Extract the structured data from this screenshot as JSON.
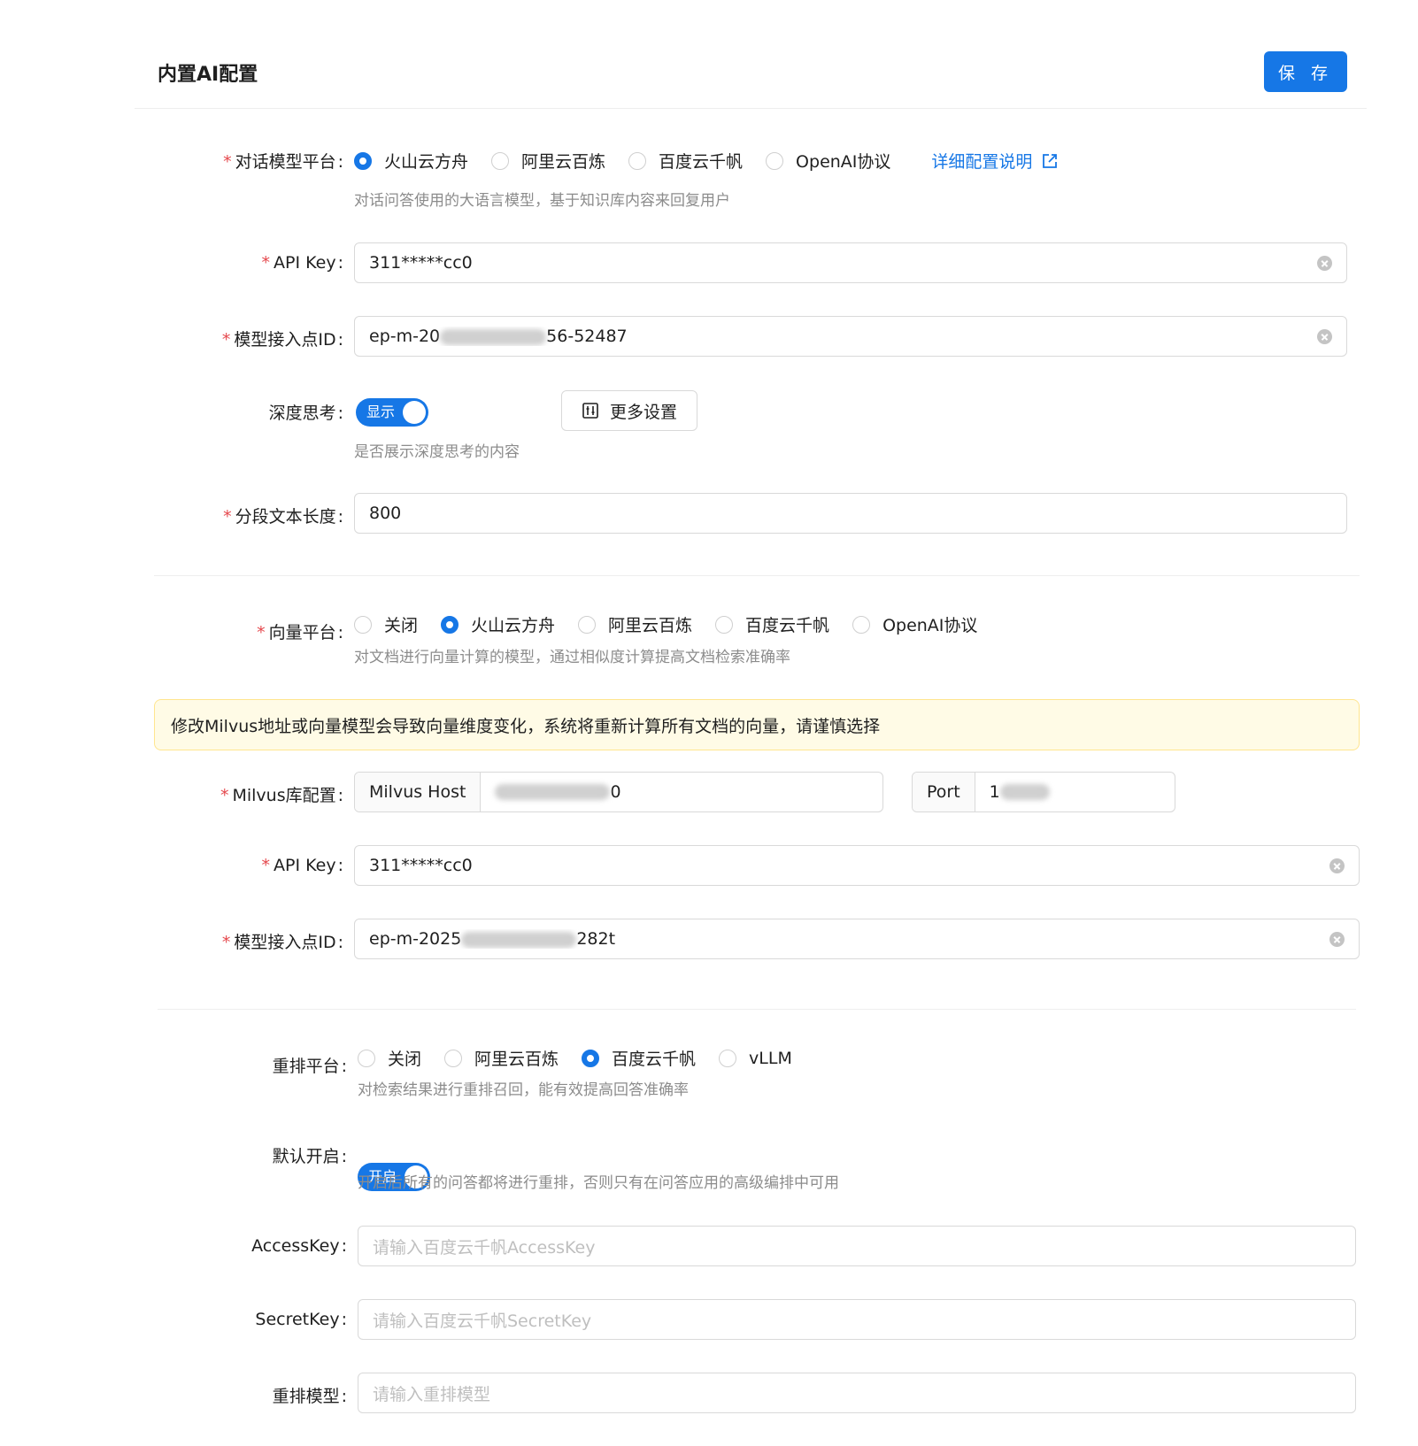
{
  "header": {
    "title": "内置AI配置",
    "save_label": "保 存"
  },
  "chat": {
    "platform_label": "对话模型平台",
    "platform_options": [
      "火山云方舟",
      "阿里云百炼",
      "百度云千帆",
      "OpenAI协议"
    ],
    "platform_selected": "火山云方舟",
    "detail_link": "详细配置说明",
    "platform_help": "对话问答使用的大语言模型，基于知识库内容来回复用户",
    "api_key_label": "API Key",
    "api_key_value": "311*****cc0",
    "endpoint_label": "模型接入点ID",
    "endpoint_prefix": "ep-m-20",
    "endpoint_suffix": "56-52487",
    "deep_think_label": "深度思考",
    "deep_think_switch_text": "显示",
    "deep_think_help": "是否展示深度思考的内容",
    "more_settings_label": "更多设置",
    "segment_label": "分段文本长度",
    "segment_value": "800"
  },
  "vector": {
    "platform_label": "向量平台",
    "platform_options": [
      "关闭",
      "火山云方舟",
      "阿里云百炼",
      "百度云千帆",
      "OpenAI协议"
    ],
    "platform_selected": "火山云方舟",
    "platform_help": "对文档进行向量计算的模型，通过相似度计算提高文档检索准确率",
    "alert_text": "修改Milvus地址或向量模型会导致向量维度变化，系统将重新计算所有文档的向量，请谨慎选择",
    "milvus_label": "Milvus库配置",
    "milvus_host_addon": "Milvus Host",
    "milvus_host_suffix": "0",
    "milvus_port_addon": "Port",
    "milvus_port_prefix": "1",
    "api_key_label": "API Key",
    "api_key_value": "311*****cc0",
    "endpoint_label": "模型接入点ID",
    "endpoint_prefix": "ep-m-2025",
    "endpoint_suffix": "282t"
  },
  "rerank": {
    "platform_label": "重排平台",
    "platform_options": [
      "关闭",
      "阿里云百炼",
      "百度云千帆",
      "vLLM"
    ],
    "platform_selected": "百度云千帆",
    "platform_help": "对检索结果进行重排召回，能有效提高回答准确率",
    "default_on_label": "默认开启",
    "default_on_switch_text": "开启",
    "default_on_help": "开启后所有的问答都将进行重排，否则只有在问答应用的高级编排中可用",
    "access_key_label": "AccessKey",
    "access_key_placeholder": "请输入百度云千帆AccessKey",
    "secret_key_label": "SecretKey",
    "secret_key_placeholder": "请输入百度云千帆SecretKey",
    "model_label": "重排模型",
    "model_placeholder": "请输入重排模型"
  },
  "colors": {
    "primary": "#1677e6",
    "required": "#e5484d",
    "alert_bg": "#fffbe6",
    "alert_border": "#ffe58f"
  }
}
